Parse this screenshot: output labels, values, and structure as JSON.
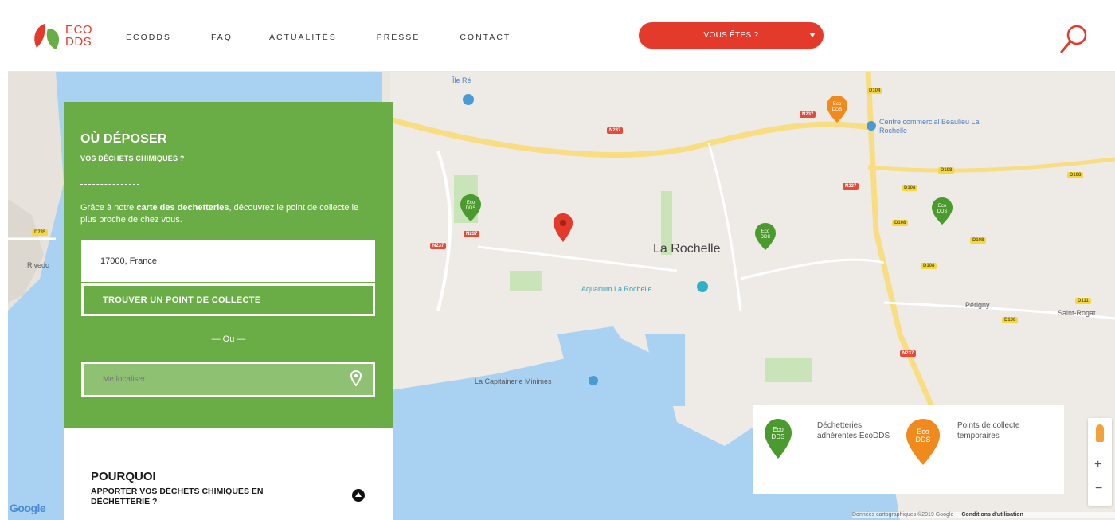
{
  "header": {
    "logo": {
      "line1": "ECO",
      "line2": "DDS"
    },
    "nav": [
      "ECODDS",
      "FAQ",
      "ACTUALITÉS",
      "PRESSE",
      "CONTACT"
    ],
    "vous_etes": "VOUS ÊTES ?",
    "colors": {
      "accent": "#e33a2b",
      "brand_green": "#6aac45"
    }
  },
  "panel": {
    "title": "OÙ DÉPOSER",
    "subtitle": "VOS DÉCHETS CHIMIQUES ?",
    "intro_before": "Grâce à notre ",
    "intro_bold": "carte des dechetteries",
    "intro_after": ", découvrez le point de collecte le plus proche de chez vous.",
    "address_value": "17000, France",
    "find_button": "TROUVER UN POINT DE COLLECTE",
    "or_text": "— Ou —",
    "locate_placeholder": "Me localiser"
  },
  "why": {
    "title": "POURQUOI",
    "subtitle": "APPORTER VOS DÉCHETS CHIMIQUES EN DÉCHETTERIE ?"
  },
  "map": {
    "city_label": "La Rochelle",
    "labels": {
      "aquarium": "Aquarium La Rochelle",
      "commercial": "Centre commercial Beaulieu La Rochelle",
      "minimes": "La Capitainerie Minimes",
      "perigny": "Périgny",
      "saint_rogatien": "Saint-Rogat",
      "rivedoux": "Rivedo",
      "top": "Île Ré"
    },
    "google": "Google",
    "attribution": "Données cartographiques ©2019 Google",
    "terms": "Conditions d'utilisation"
  },
  "legend": {
    "green_label": "Déchetteries adhérentes EcoDDS",
    "orange_label": "Points de collecte temporaires",
    "marker_text": "Eco DDS"
  },
  "icons": [
    "search-icon",
    "caret-down-icon",
    "location-pin-icon",
    "chevron-up-icon",
    "map-marker-icon",
    "pegman-icon"
  ]
}
